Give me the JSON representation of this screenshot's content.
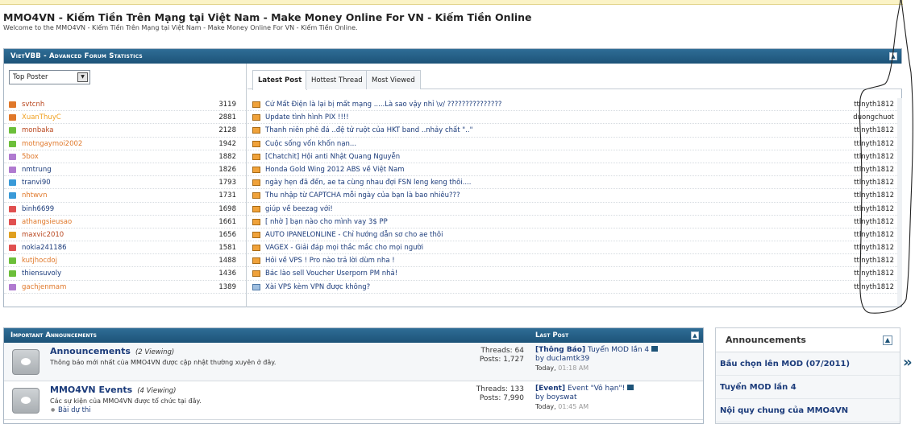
{
  "site": {
    "title": "MMO4VN - Kiếm Tiền Trên Mạng tại Việt Nam - Make Money Online For VN - Kiếm Tiền Online",
    "subtitle": "Welcome to the MMO4VN - Kiếm Tiền Trên Mạng tại Việt Nam - Make Money Online For VN - Kiếm Tiền Online."
  },
  "stats": {
    "title": "VietVBB - Advanced Forum Statistics",
    "select_value": "Top Poster",
    "tabs": [
      "Latest Post",
      "Hottest Thread",
      "Most Viewed"
    ],
    "posters": [
      {
        "name": "svtcnh",
        "count": "3119",
        "color": "#b8451c",
        "icon": "#e0782a"
      },
      {
        "name": "XuanThuyC",
        "count": "2881",
        "color": "#f0a020",
        "icon": "#e0782a"
      },
      {
        "name": "monbaka",
        "count": "2128",
        "color": "#b8451c",
        "icon": "#6cbf3a"
      },
      {
        "name": "motngaymoi2002",
        "count": "1942",
        "color": "#e0782a",
        "icon": "#6cbf3a"
      },
      {
        "name": "5box",
        "count": "1882",
        "color": "#e0782a",
        "icon": "#b07ad0"
      },
      {
        "name": "nmtrung",
        "count": "1826",
        "color": "#1b3b7a",
        "icon": "#b07ad0"
      },
      {
        "name": "tranvi90",
        "count": "1793",
        "color": "#1b3b7a",
        "icon": "#3a9ad8"
      },
      {
        "name": "nhtwvn",
        "count": "1731",
        "color": "#e0782a",
        "icon": "#3a9ad8"
      },
      {
        "name": "binh6699",
        "count": "1698",
        "color": "#1b3b7a",
        "icon": "#e05050"
      },
      {
        "name": "athangsieusao",
        "count": "1661",
        "color": "#e0782a",
        "icon": "#e05050"
      },
      {
        "name": "maxvic2010",
        "count": "1656",
        "color": "#b8451c",
        "icon": "#e0a020"
      },
      {
        "name": "nokia241186",
        "count": "1581",
        "color": "#1b3b7a",
        "icon": "#e05050"
      },
      {
        "name": "kutjhocdoj",
        "count": "1488",
        "color": "#e0782a",
        "icon": "#6cbf3a"
      },
      {
        "name": "thiensuvoly",
        "count": "1436",
        "color": "#1b3b7a",
        "icon": "#6cbf3a"
      },
      {
        "name": "gachjenmam",
        "count": "1389",
        "color": "#e0782a",
        "icon": "#b07ad0"
      }
    ],
    "posts": [
      {
        "title": "Cứ Mất Điện là lại bị mất mạng .....Là sao vậy nhỉ \\v/ ???????????????",
        "user": "ttlnyth1812"
      },
      {
        "title": "Update tình hình PIX !!!!",
        "user": "duongchuot"
      },
      {
        "title": "Thanh niên phê đá ..đệ tử ruột của HKT band ..nhảy chất \"..\"",
        "user": "ttlnyth1812"
      },
      {
        "title": "Cuộc sống vốn khốn nạn...",
        "user": "ttlnyth1812"
      },
      {
        "title": "[Chatchit] Hội anti Nhật Quang Nguyễn",
        "user": "ttlnyth1812"
      },
      {
        "title": "Honda Gold Wing 2012 ABS về Việt Nam",
        "user": "ttlnyth1812"
      },
      {
        "title": "ngày hẹn đã đến, ae ta cùng nhau đợi FSN leng keng thôi....",
        "user": "ttlnyth1812"
      },
      {
        "title": "Thu nhập từ CAPTCHA mỗi ngày của bạn là bao nhiêu???",
        "user": "ttlnyth1812"
      },
      {
        "title": "giúp về beezag với!",
        "user": "ttlnyth1812"
      },
      {
        "title": "[ nhờ ] bạn nào cho mình vay 3$ PP",
        "user": "ttlnyth1812"
      },
      {
        "title": "AUTO IPANELONLINE - Chỉ hướng dẫn sơ cho ae thôi",
        "user": "ttlnyth1812"
      },
      {
        "title": "VAGEX - Giải đáp mọi thắc mắc cho mọi người",
        "user": "ttlnyth1812"
      },
      {
        "title": "Hỏi về VPS ! Pro nào trả lời dùm nha !",
        "user": "ttlnyth1812"
      },
      {
        "title": "Bác lào sell Voucher Userporn PM nhả!",
        "user": "ttlnyth1812"
      },
      {
        "title": "Xài VPS kèm VPN được không?",
        "user": "ttlnyth1812"
      }
    ]
  },
  "announcements": {
    "title": "Important Announcements",
    "last_post_header": "Last Post",
    "forums": [
      {
        "name": "Announcements",
        "viewing": "(2 Viewing)",
        "desc": "Thông báo mới nhất của MMO4VN được cập nhật thường xuyên ở đây.",
        "sub": "",
        "threads": "Threads: 64",
        "posts": "Posts: 1,727",
        "lp_prefix": "[Thông Báo]",
        "lp_title": "Tuyển MOD lần 4",
        "lp_by": "by duclamtk39",
        "lp_day": "Today,",
        "lp_time": "01:18 AM"
      },
      {
        "name": "MMO4VN Events",
        "viewing": "(4 Viewing)",
        "desc": "Các sự kiện của MMO4VN được tổ chức tại đây.",
        "sub": "Bài dự thi",
        "threads": "Threads: 133",
        "posts": "Posts: 7,990",
        "lp_prefix": "[Event]",
        "lp_title": "Event \"Vô hạn\"!",
        "lp_by": "by boyswat",
        "lp_day": "Today,",
        "lp_time": "01:45 AM"
      }
    ]
  },
  "sidebar": {
    "title": "Announcements",
    "items": [
      "Bầu chọn lên MOD (07/2011)",
      "Tuyển MOD lần 4",
      "Nội quy chung của MMO4VN"
    ]
  }
}
